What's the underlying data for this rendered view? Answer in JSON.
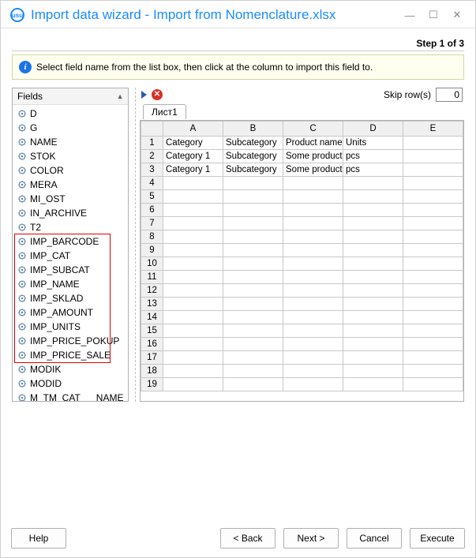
{
  "window": {
    "title": "Import data wizard - Import from Nomenclature.xlsx",
    "step_label": "Step 1 of 3"
  },
  "info": {
    "text": "Select field name from the list box, then click at the column to import this field to."
  },
  "fields_panel": {
    "header": "Fields",
    "items": [
      "D",
      "G",
      "NAME",
      "STOK",
      "COLOR",
      "MERA",
      "MI_OST",
      "IN_ARCHIVE",
      "T2",
      "IMP_BARCODE",
      "IMP_CAT",
      "IMP_SUBCAT",
      "IMP_NAME",
      "IMP_SKLAD",
      "IMP_AMOUNT",
      "IMP_UNITS",
      "IMP_PRICE_POKUP",
      "IMP_PRICE_SALE",
      "MODIK",
      "MODID",
      "M_TM_CAT___NAME"
    ],
    "highlight_start_index": 9,
    "highlight_end_index": 17
  },
  "sheet": {
    "skip_label": "Skip row(s)",
    "skip_value": "0",
    "tabs": [
      "Лист1"
    ],
    "columns": [
      "A",
      "B",
      "C",
      "D",
      "E"
    ],
    "row_count": 19,
    "rows": [
      [
        "Category",
        "Subcategory",
        "Product name",
        "Units",
        ""
      ],
      [
        "Category 1",
        "Subcategory",
        "Some product",
        "pcs",
        ""
      ],
      [
        "Category 1",
        "Subcategory",
        "Some product",
        "pcs",
        ""
      ]
    ]
  },
  "buttons": {
    "help": "Help",
    "back": "< Back",
    "next": "Next >",
    "cancel": "Cancel",
    "execute": "Execute"
  }
}
